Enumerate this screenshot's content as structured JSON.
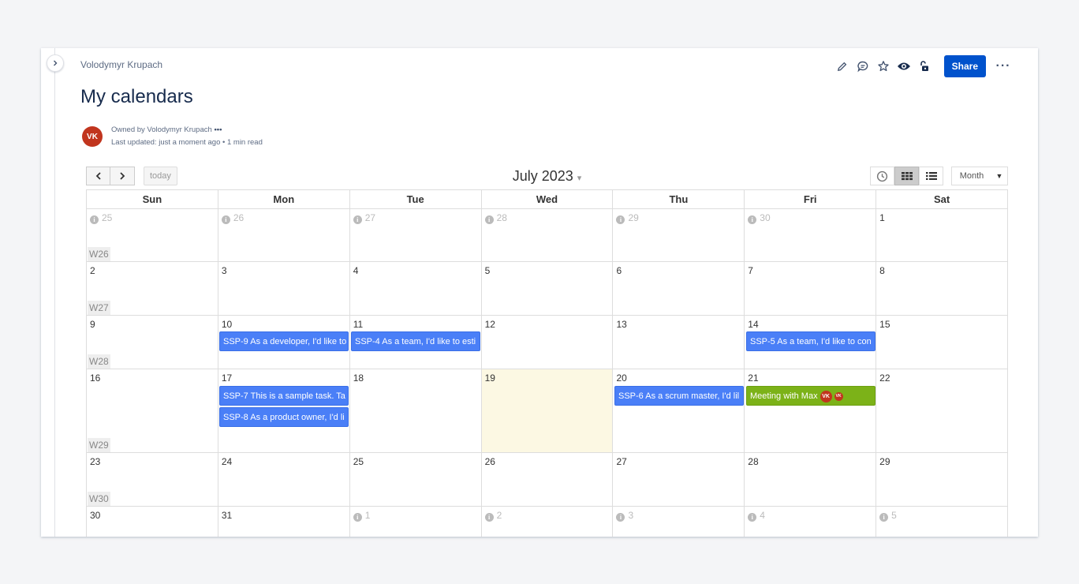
{
  "breadcrumb": "Volodymyr Krupach",
  "page_title": "My calendars",
  "toolbar": {
    "share_label": "Share",
    "icons": [
      "pencil-icon",
      "comment-icon",
      "star-icon",
      "watch-eye-icon",
      "unlock-icon",
      "more-icon"
    ]
  },
  "byline": {
    "avatar_initials": "VK",
    "owner": "Owned by Volodymyr Krupach",
    "owner_more": "•••",
    "updated": "Last updated: just a moment ago",
    "read_time": "1 min read"
  },
  "calendar": {
    "today_label": "today",
    "month_title": "July 2023",
    "view_select": "Month",
    "weekdays": [
      "Sun",
      "Mon",
      "Tue",
      "Wed",
      "Thu",
      "Fri",
      "Sat"
    ],
    "weeks": [
      {
        "label": "W26",
        "days": [
          "25",
          "26",
          "27",
          "28",
          "29",
          "30",
          "1"
        ]
      },
      {
        "label": "W27",
        "days": [
          "2",
          "3",
          "4",
          "5",
          "6",
          "7",
          "8"
        ]
      },
      {
        "label": "W28",
        "days": [
          "9",
          "10",
          "11",
          "12",
          "13",
          "14",
          "15"
        ]
      },
      {
        "label": "W29",
        "days": [
          "16",
          "17",
          "18",
          "19",
          "20",
          "21",
          "22"
        ]
      },
      {
        "label": "W30",
        "days": [
          "23",
          "24",
          "25",
          "26",
          "27",
          "28",
          "29"
        ]
      },
      {
        "label": "",
        "days": [
          "30",
          "31",
          "1",
          "2",
          "3",
          "4",
          "5"
        ]
      }
    ],
    "events": [
      {
        "title": "SSP-9 As a developer, I'd like to"
      },
      {
        "title": "SSP-4 As a team, I'd like to esti"
      },
      {
        "title": "SSP-5 As a team, I'd like to con"
      },
      {
        "title": "SSP-7 This is a sample task. Ta"
      },
      {
        "title": "SSP-8 As a product owner, I'd li"
      },
      {
        "title": "SSP-6 As a scrum master, I'd lil"
      },
      {
        "title": "Meeting with Max",
        "avatars": [
          "VK",
          "VK"
        ]
      }
    ],
    "colors": {
      "event_blue": "#4a7ff7",
      "event_green": "#7cb218",
      "today_bg": "#fcf8e3",
      "avatar": "#c1351e",
      "share": "#0052cc"
    }
  }
}
